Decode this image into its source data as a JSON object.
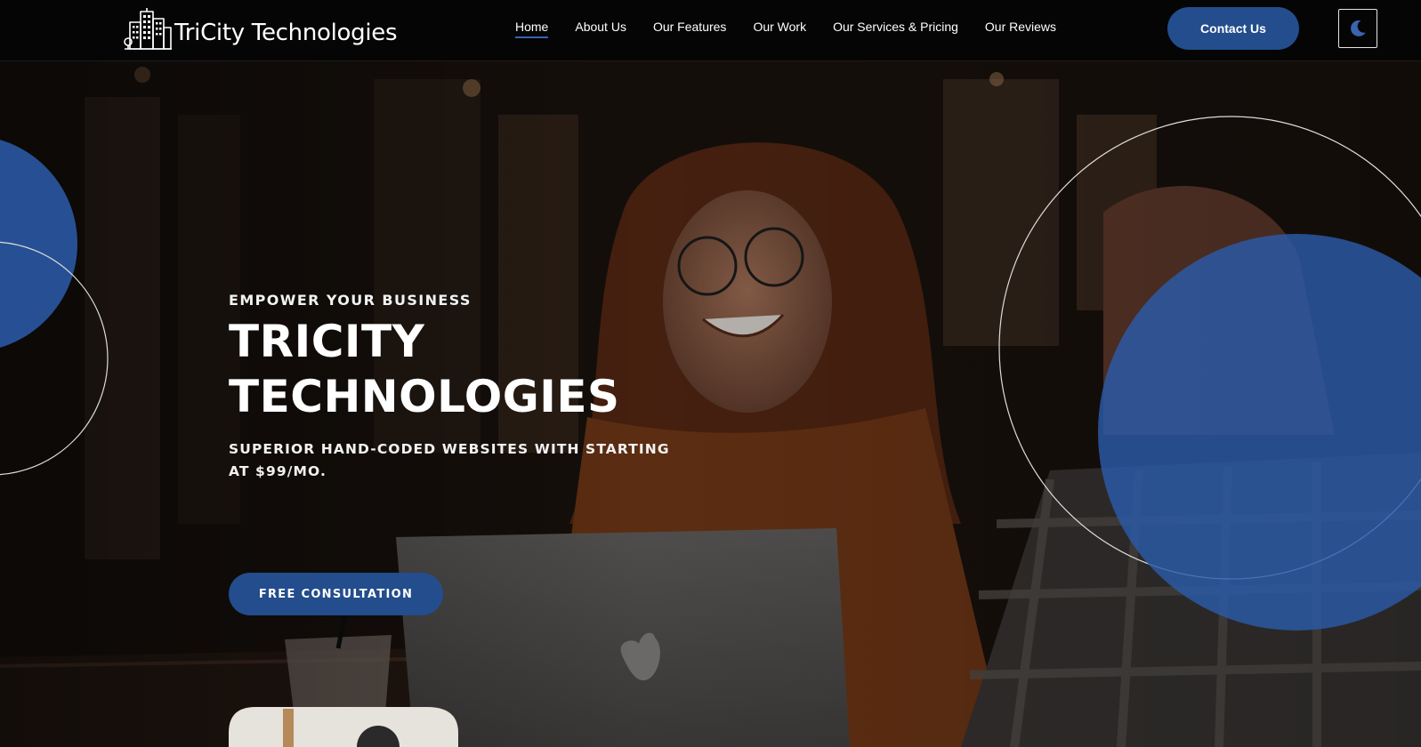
{
  "brand": {
    "name": "TriCity Technologies",
    "logo_icon": "city-buildings-icon"
  },
  "nav": {
    "items": [
      {
        "label": "Home",
        "active": true
      },
      {
        "label": "About Us",
        "active": false
      },
      {
        "label": "Our Features",
        "active": false
      },
      {
        "label": "Our Work",
        "active": false
      },
      {
        "label": "Our Services & Pricing",
        "active": false
      },
      {
        "label": "Our Reviews",
        "active": false
      }
    ],
    "contact_label": "Contact Us",
    "theme_toggle_icon": "moon-icon"
  },
  "hero": {
    "eyebrow": "EMPOWER YOUR BUSINESS",
    "title": "TRICITY\nTECHNOLOGIES",
    "subtitle": "SUPERIOR HAND-CODED WEBSITES WITH STARTING AT $99/MO.",
    "cta_label": "FREE CONSULTATION"
  },
  "colors": {
    "header_bg": "#050505",
    "accent": "#234d8c",
    "nav_active_underline": "#3a62b0",
    "decor_circle": "#2b5aa8"
  }
}
